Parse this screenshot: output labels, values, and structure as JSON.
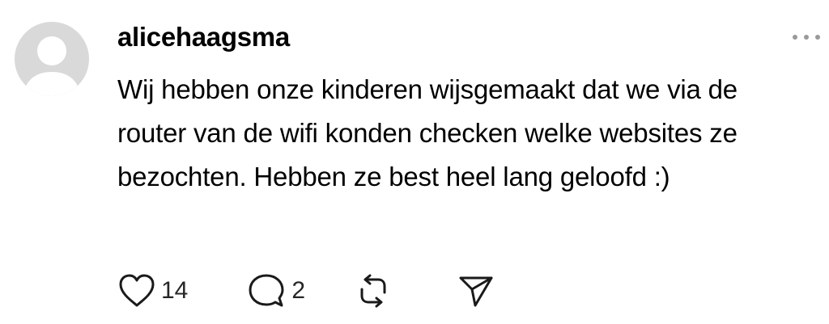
{
  "post": {
    "username": "alicehaagsma",
    "text": "Wij hebben onze kinderen wijsgemaakt dat we via de router van de wifi konden checken welke websites ze bezochten. Hebben ze best heel lang geloofd :)",
    "likes": "14",
    "replies": "2"
  },
  "icons": {
    "avatar": "default-avatar-icon",
    "more": "more-icon",
    "like": "heart-icon",
    "reply": "comment-icon",
    "repost": "repost-icon",
    "share": "send-icon"
  },
  "colors": {
    "text": "#000000",
    "icon": "#1a1a1a",
    "avatar_bg": "#d9d9d9",
    "avatar_fg": "#ffffff",
    "muted": "#9a9a9a"
  }
}
